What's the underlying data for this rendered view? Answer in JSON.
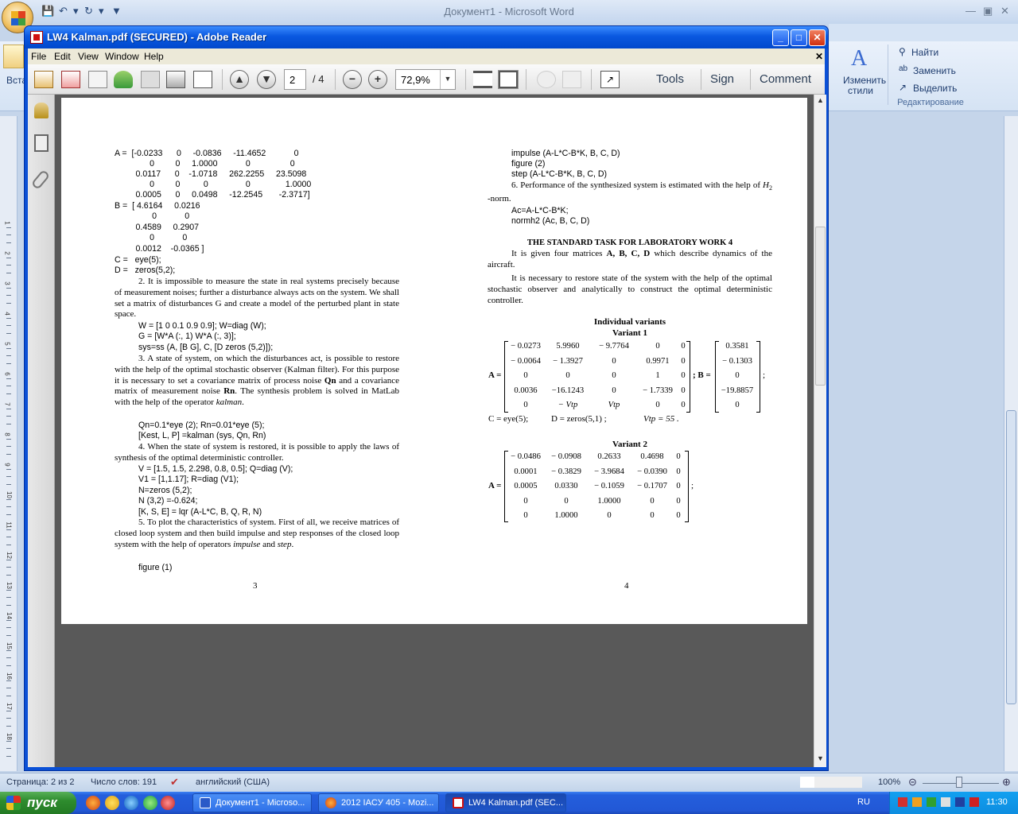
{
  "word": {
    "title": "Документ1 - Microsoft Word",
    "partial_left_label": "Вста",
    "ribbon": {
      "styles_label_1": "Изменить",
      "styles_label_2": "стили",
      "find": "Найти",
      "replace": "Заменить",
      "select": "Выделить",
      "group_label": "Редактирование"
    },
    "status": {
      "page": "Страница: 2 из 2",
      "words": "Число слов: 191",
      "language": "английский (США)",
      "zoom": "100%"
    },
    "ruler_numbers": [
      "1",
      "2",
      "3",
      "4",
      "5",
      "6",
      "7",
      "8",
      "9",
      "10",
      "11",
      "12",
      "13",
      "14",
      "15",
      "16",
      "17",
      "18"
    ]
  },
  "adobe": {
    "title": "LW4 Kalman.pdf (SECURED) - Adobe Reader",
    "menu": [
      "File",
      "Edit",
      "View",
      "Window",
      "Help"
    ],
    "page_current": "2",
    "page_total": "/  4",
    "zoom": "72,9%",
    "tools": "Tools",
    "sign": "Sign",
    "comment": "Comment"
  },
  "pdf": {
    "left": {
      "matrixA": [
        "A =  [-0.0233      0     -0.0836     -11.4652            0",
        "               0         0     1.0000            0                 0",
        "         0.0117      0    -1.0718     262.2255     23.5098",
        "               0         0          0                0               1.0000",
        "         0.0005      0     0.0498     -12.2545       -2.3717]"
      ],
      "matrixB": [
        "B =  [ 4.6164     0.0216",
        "                0            0",
        "         0.4589     0.2907",
        "               0            0",
        "         0.0012    -0.0365 ]"
      ],
      "c_line": "C =   eye(5);",
      "d_line": "D =   zeros(5,2);",
      "p2": "2. It is impossible to measure the state in real systems precisely because of measurement noises; further a disturbance always acts on the system. We shall set a matrix of disturbances G and create a model of the perturbed plant in state space.",
      "code2": [
        "W = [1 0 0.1 0.9 0.9]; W=diag (W);",
        "G = [W*A (:, 1) W*A (:, 3)];",
        "sys=ss (A, [B G], C, [D zeros (5,2)]);"
      ],
      "p3a": "3. A state of system, on which the disturbances act, is possible to restore with the help of the optimal stochastic observer (Kalman filter). For this purpose it is necessary to set a covariance matrix of process noise ",
      "p3_qn": "Qn",
      "p3b": " and a covariance matrix of measurement noise ",
      "p3_rn": "Rn",
      "p3c": ". The synthesis problem is solved in MatLab with the help of the operator ",
      "p3_kalman": "kalman",
      "p3d": ".",
      "code3": [
        "Qn=0.1*eye (2); Rn=0.01*eye (5);",
        "[Kest, L, P] =kalman (sys, Qn, Rn)"
      ],
      "p4": "4. When the state of system is restored, it is possible to apply the laws of synthesis of the optimal deterministic controller.",
      "code4": [
        "V = [1.5, 1.5, 2.298, 0.8, 0.5]; Q=diag (V);",
        "V1 = [1,1.17]; R=diag (V1);",
        "N=zeros (5,2);",
        "N (3,2) =-0.624;",
        "[K, S, E] = lqr (A-L*C, B, Q, R, N)"
      ],
      "p5a": "5. To plot the characteristics of system. First of all, we receive matrices of closed loop system and then build impulse and step responses of the closed loop system with the help of operators ",
      "p5_impulse": "impulse",
      "p5b": " and ",
      "p5_step": "step",
      "p5c": ".",
      "code5": "figure (1)",
      "page_num": "3"
    },
    "right": {
      "code_top": [
        "impulse (A-L*C-B*K, B, C, D)",
        "figure (2)",
        "step (A-L*C-B*K, B, C, D)"
      ],
      "p6a": "6. Performance of the synthesized system is estimated with the help of ",
      "p6_h": "H",
      "p6_sub": "2",
      "p6b": " -norm.",
      "code6": [
        "Ac=A-L*C-B*K;",
        "normh2 (Ac, B, C, D)"
      ],
      "std_title": "THE STANDARD TASK FOR LABORATORY WORK 4",
      "std_p1a": "It is given four matrices  ",
      "std_p1_bold": "A, B, C, D",
      "std_p1b": "  which describe dynamics of the aircraft.",
      "std_p2": "It is necessary to restore state of the system with the help of the optimal stochastic observer and analytically to construct the optimal deterministic controller.",
      "iv_title": "Individual variants",
      "v1_title": "Variant 1",
      "v1_A": [
        [
          "− 0.0273",
          "5.9960",
          "− 9.7764",
          "0",
          "0"
        ],
        [
          "− 0.0064",
          "− 1.3927",
          "0",
          "0.9971",
          "0"
        ],
        [
          "0",
          "0",
          "0",
          "1",
          "0"
        ],
        [
          "0.0036",
          "−16.1243",
          "0",
          "− 1.7339",
          "0"
        ],
        [
          "0",
          "− Vtp",
          "Vtp",
          "0",
          "0"
        ]
      ],
      "v1_B": [
        "0.3581",
        "− 0.1303",
        "0",
        "−19.8857",
        "0"
      ],
      "a_eq": "A =",
      "b_eq": "; B =",
      "semi": ";",
      "v1_c": "C = eye(5);",
      "v1_d": "D = zeros(5,1) ;",
      "v1_vtp": "Vtp = 55 .",
      "v2_title": "Variant 2",
      "v2_A": [
        [
          "− 0.0486",
          "− 0.0908",
          "0.2633",
          "0.4698",
          "0"
        ],
        [
          "0.0001",
          "− 0.3829",
          "− 3.9684",
          "− 0.0390",
          "0"
        ],
        [
          "0.0005",
          "0.0330",
          "− 0.1059",
          "− 0.1707",
          "0"
        ],
        [
          "0",
          "0",
          "1.0000",
          "0",
          "0"
        ],
        [
          "0",
          "1.0000",
          "0",
          "0",
          "0"
        ]
      ],
      "page_num": "4"
    }
  },
  "taskbar": {
    "start": "пуск",
    "items": [
      "Документ1 - Microso...",
      "2012 IACУ 405 - Mozi...",
      "LW4 Kalman.pdf (SEC..."
    ],
    "lang": "RU",
    "clock": "11:30"
  }
}
